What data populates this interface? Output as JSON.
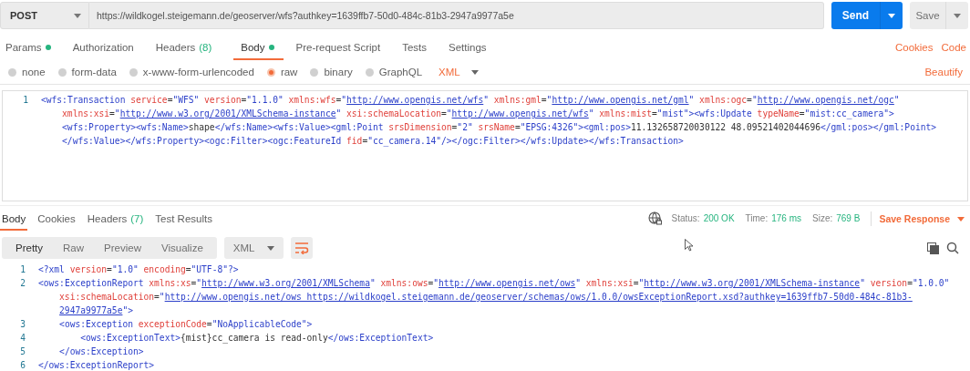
{
  "request": {
    "method": "POST",
    "url": "https://wildkogel.steigemann.de/geoserver/wfs?authkey=1639ffb7-50d0-484c-81b3-2947a9977a5e",
    "send": "Send",
    "save": "Save"
  },
  "request_tabs": [
    {
      "label": "Params",
      "dot": true,
      "selected": false
    },
    {
      "label": "Authorization",
      "dot": false,
      "selected": false
    },
    {
      "label": "Headers",
      "count": "(8)",
      "dot": false,
      "selected": false
    },
    {
      "label": "Body",
      "dot": true,
      "selected": true
    },
    {
      "label": "Pre-request Script",
      "dot": false,
      "selected": false
    },
    {
      "label": "Tests",
      "dot": false,
      "selected": false
    },
    {
      "label": "Settings",
      "dot": false,
      "selected": false
    }
  ],
  "request_links": [
    "Cookies",
    "Code"
  ],
  "body_types": [
    {
      "label": "none",
      "selected": false
    },
    {
      "label": "form-data",
      "selected": false
    },
    {
      "label": "x-www-form-urlencoded",
      "selected": false
    },
    {
      "label": "raw",
      "selected": true
    },
    {
      "label": "binary",
      "selected": false
    },
    {
      "label": "GraphQL",
      "selected": false
    }
  ],
  "body_format": "XML",
  "beautify": "Beautify",
  "request_body": {
    "lines": [
      {
        "number": "1",
        "text": "<wfs:Transaction service=\"WFS\" version=\"1.1.0\" xmlns:wfs=\"http://www.opengis.net/wfs\" xmlns:gml=\"http://www.opengis.net/gml\" xmlns:ogc=\"http://www.opengis.net/ogc\" xmlns:xsi=\"http://www.w3.org/2001/XMLSchema-instance\" xsi:schemaLocation=\"http://www.opengis.net/wfs\" xmlns:mist=\"mist\"><wfs:Update typeName=\"mist:cc_camera\"><wfs:Property><wfs:Name>shape</wfs:Name><wfs:Value><gml:Point srsDimension=\"2\" srsName=\"EPSG:4326\"><gml:pos>11.132658720030122 48.09521402044696</gml:pos></gml:Point></wfs:Value></wfs:Property><ogc:Filter><ogc:FeatureId fid=\"cc_camera.14\"/></ogc:Filter></wfs:Update></wfs:Transaction>"
      }
    ]
  },
  "response_tabs": [
    {
      "label": "Body",
      "selected": true
    },
    {
      "label": "Cookies",
      "selected": false
    },
    {
      "label": "Headers",
      "count": "(7)",
      "selected": false
    },
    {
      "label": "Test Results",
      "selected": false
    }
  ],
  "response_meta": [
    {
      "label": "Status:",
      "value": "200 OK"
    },
    {
      "label": "Time:",
      "value": "176 ms"
    },
    {
      "label": "Size:",
      "value": "769 B"
    }
  ],
  "save_response": "Save Response",
  "view_modes": [
    {
      "label": "Pretty",
      "selected": true
    },
    {
      "label": "Raw",
      "selected": false
    },
    {
      "label": "Preview",
      "selected": false
    },
    {
      "label": "Visualize",
      "selected": false
    }
  ],
  "response_format": "XML",
  "response_body": {
    "lines": [
      {
        "number": "1",
        "text": "<?xml version=\"1.0\" encoding=\"UTF-8\"?>"
      },
      {
        "number": "2",
        "text": "<ows:ExceptionReport xmlns:xs=\"http://www.w3.org/2001/XMLSchema\" xmlns:ows=\"http://www.opengis.net/ows\" xmlns:xsi=\"http://www.w3.org/2001/XMLSchema-instance\" version=\"1.0.0\" xsi:schemaLocation=\"http://www.opengis.net/ows https://wildkogel.steigemann.de/geoserver/schemas/ows/1.0.0/owsExceptionReport.xsd?authkey=1639ffb7-50d0-484c-81b3-2947a9977a5e\">"
      },
      {
        "number": "3",
        "text": "    <ows:Exception exceptionCode=\"NoApplicableCode\">"
      },
      {
        "number": "4",
        "text": "        <ows:ExceptionText>{mist}cc_camera is read-only</ows:ExceptionText>"
      },
      {
        "number": "5",
        "text": "    </ows:Exception>"
      },
      {
        "number": "6",
        "text": "</ows:ExceptionReport>"
      }
    ]
  }
}
